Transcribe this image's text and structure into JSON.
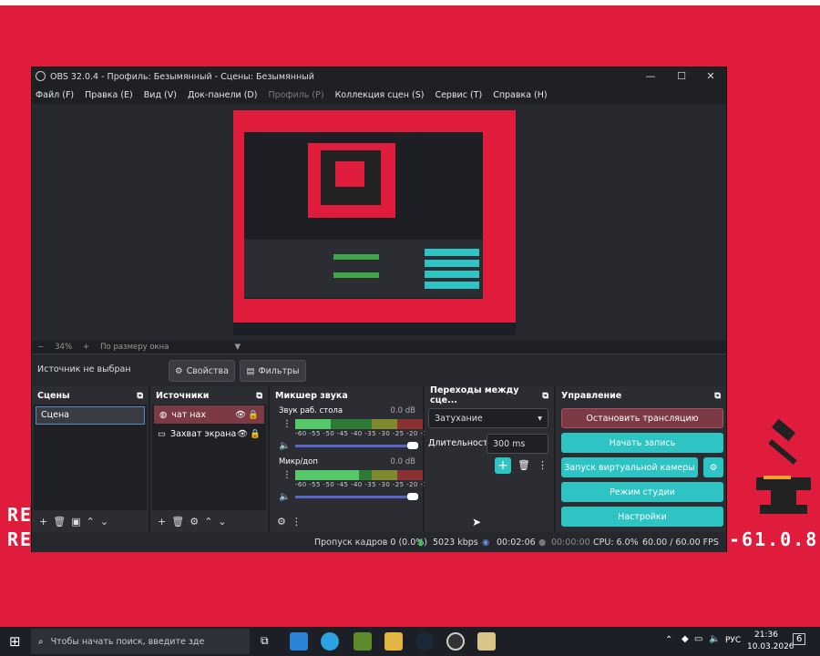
{
  "obs_window": {
    "title": "OBS 32.0.4 - Профиль: Безымянный - Сцены: Безымянный",
    "menu": [
      {
        "label": "Файл (F)",
        "disabled": false
      },
      {
        "label": "Правка (E)",
        "disabled": false
      },
      {
        "label": "Вид (V)",
        "disabled": false
      },
      {
        "label": "Док-панели (D)",
        "disabled": false
      },
      {
        "label": "Профиль (P)",
        "disabled": true
      },
      {
        "label": "Коллекция сцен (S)",
        "disabled": false
      },
      {
        "label": "Сервис (T)",
        "disabled": false
      },
      {
        "label": "Справка (H)",
        "disabled": false
      }
    ]
  },
  "preview": {
    "zoom_minus": "−",
    "zoom_value": "34%",
    "zoom_plus": "+",
    "zoom_mode": "По размеру окна"
  },
  "source_toolbar": {
    "no_source": "Источник не выбран",
    "properties": "Свойства",
    "filters": "Фильтры"
  },
  "scenes": {
    "title": "Сцены",
    "items": [
      "Сцена"
    ]
  },
  "sources": {
    "title": "Источники",
    "items": [
      "чат нах",
      "Захват экрана"
    ]
  },
  "mixer": {
    "title": "Микшер звука",
    "channels": [
      {
        "name": "Звук раб. стола",
        "db": "0.0 dB",
        "level": 0.28
      },
      {
        "name": "Микр/доп",
        "db": "0.0 dB",
        "level": 0.5
      }
    ],
    "ticks": "-60 -55 -50 -45 -40 -35 -30 -25 -20 -15 -10 -5 0"
  },
  "transitions": {
    "title": "Переходы между сце...",
    "selected": "Затухание",
    "duration_label": "Длительность",
    "duration_value": "300 ms"
  },
  "controls": {
    "title": "Управление",
    "stop_stream": "Остановить трансляцию",
    "start_record": "Начать запись",
    "virtual_cam": "Запуск виртуальной камеры",
    "studio_mode": "Режим студии",
    "settings": "Настройки"
  },
  "status": {
    "dropped": "Пропуск кадров 0 (0.0%)",
    "bitrate": "5023 kbps",
    "stream_time": "00:02:06",
    "record_time": "00:00:00",
    "cpu": "CPU: 6.0%",
    "fps": "60.00 / 60.00 FPS"
  },
  "background": {
    "retro_text": "RE",
    "version_text": "-61.0.8"
  },
  "taskbar": {
    "search_placeholder": "Чтобы начать поиск, введите зде",
    "lang": "РУС",
    "time": "21:36",
    "date": "10.03.2026",
    "notifications": "6"
  },
  "colors": {
    "background_red": "#e01c3c",
    "accent_teal": "#2fc4c4",
    "stop_stream": "#7c3a44"
  }
}
